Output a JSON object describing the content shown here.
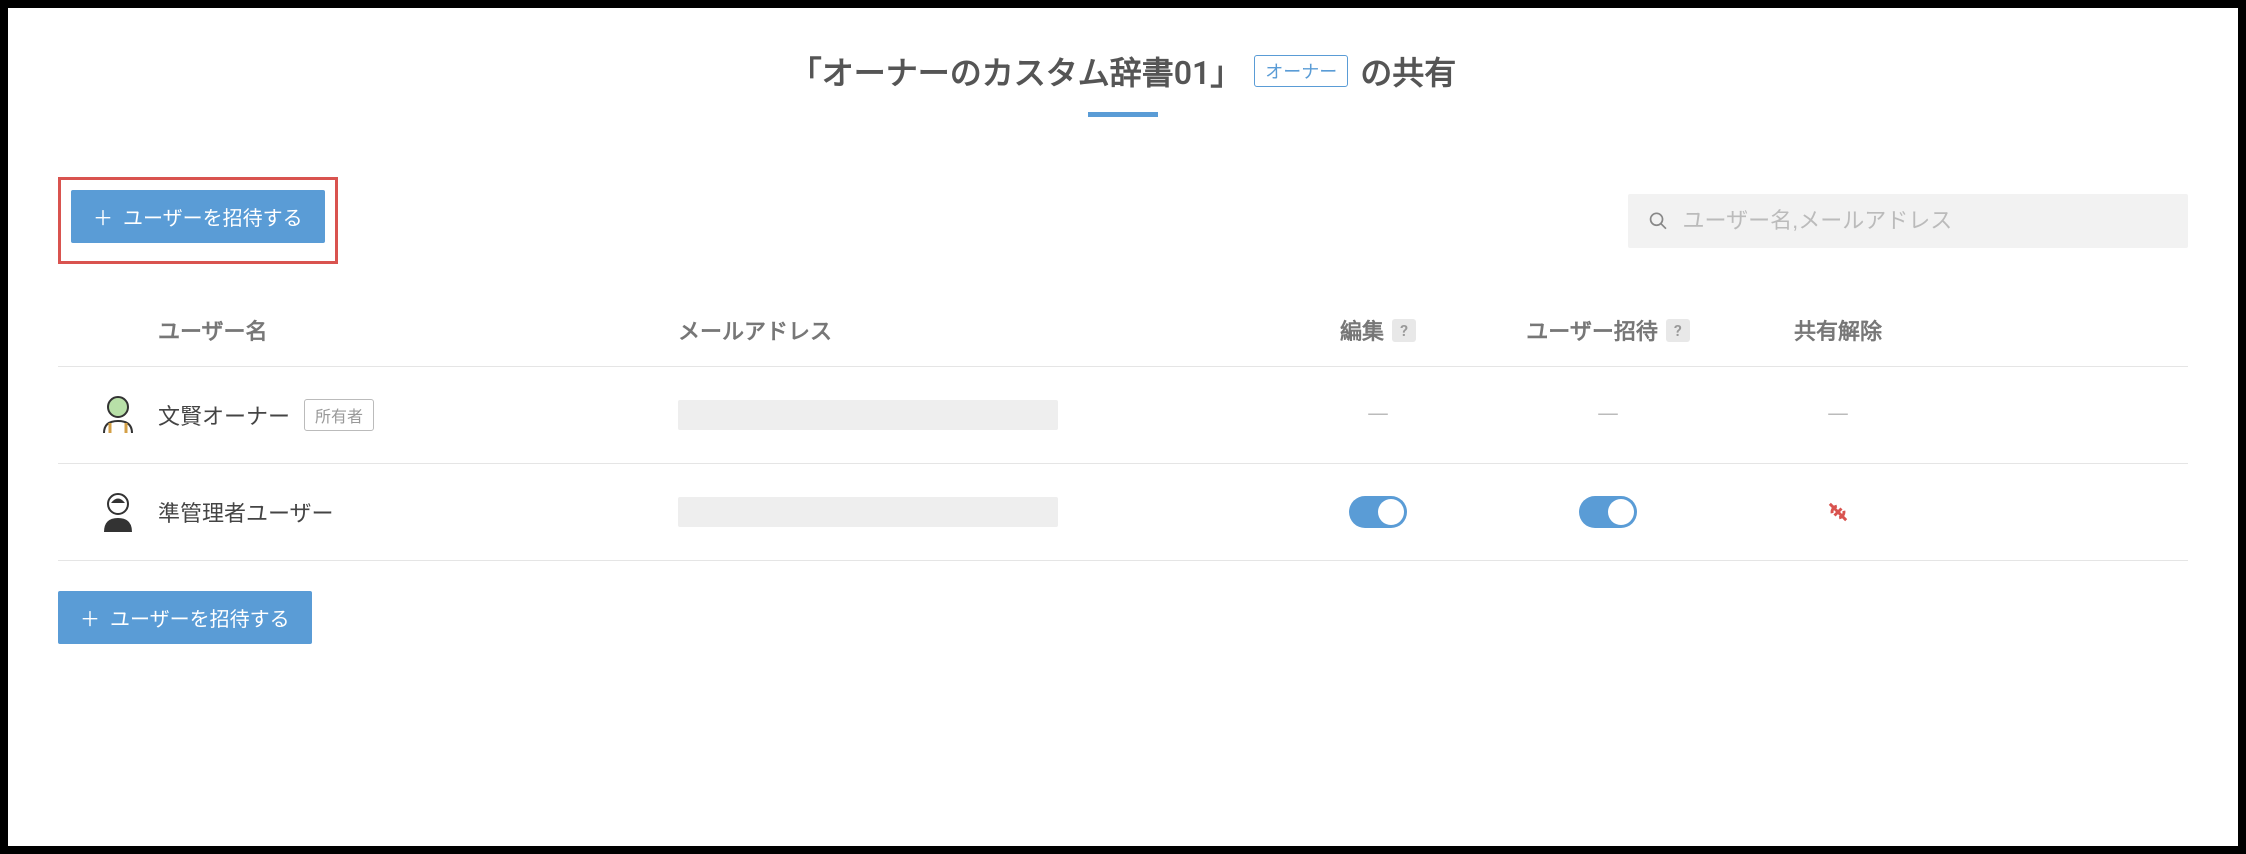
{
  "header": {
    "title_prefix": "「オーナーのカスタム辞書01」",
    "owner_badge": "オーナー",
    "title_suffix": "の共有"
  },
  "toolbar": {
    "invite_label": "ユーザーを招待する",
    "search_placeholder": "ユーザー名,メールアドレス"
  },
  "table": {
    "headers": {
      "username": "ユーザー名",
      "email": "メールアドレス",
      "edit": "編集",
      "invite": "ユーザー招待",
      "unshare": "共有解除",
      "help": "?"
    },
    "rows": [
      {
        "avatar_type": "owner",
        "username": "文賢オーナー",
        "owner_tag": "所有者",
        "email_redacted": true,
        "edit": "dash",
        "invite": "dash",
        "unshare": "dash"
      },
      {
        "avatar_type": "user",
        "username": "準管理者ユーザー",
        "owner_tag": null,
        "email_redacted": true,
        "edit": "toggle-on",
        "invite": "toggle-on",
        "unshare": "icon"
      }
    ]
  },
  "bottom": {
    "invite_label": "ユーザーを招待する"
  }
}
